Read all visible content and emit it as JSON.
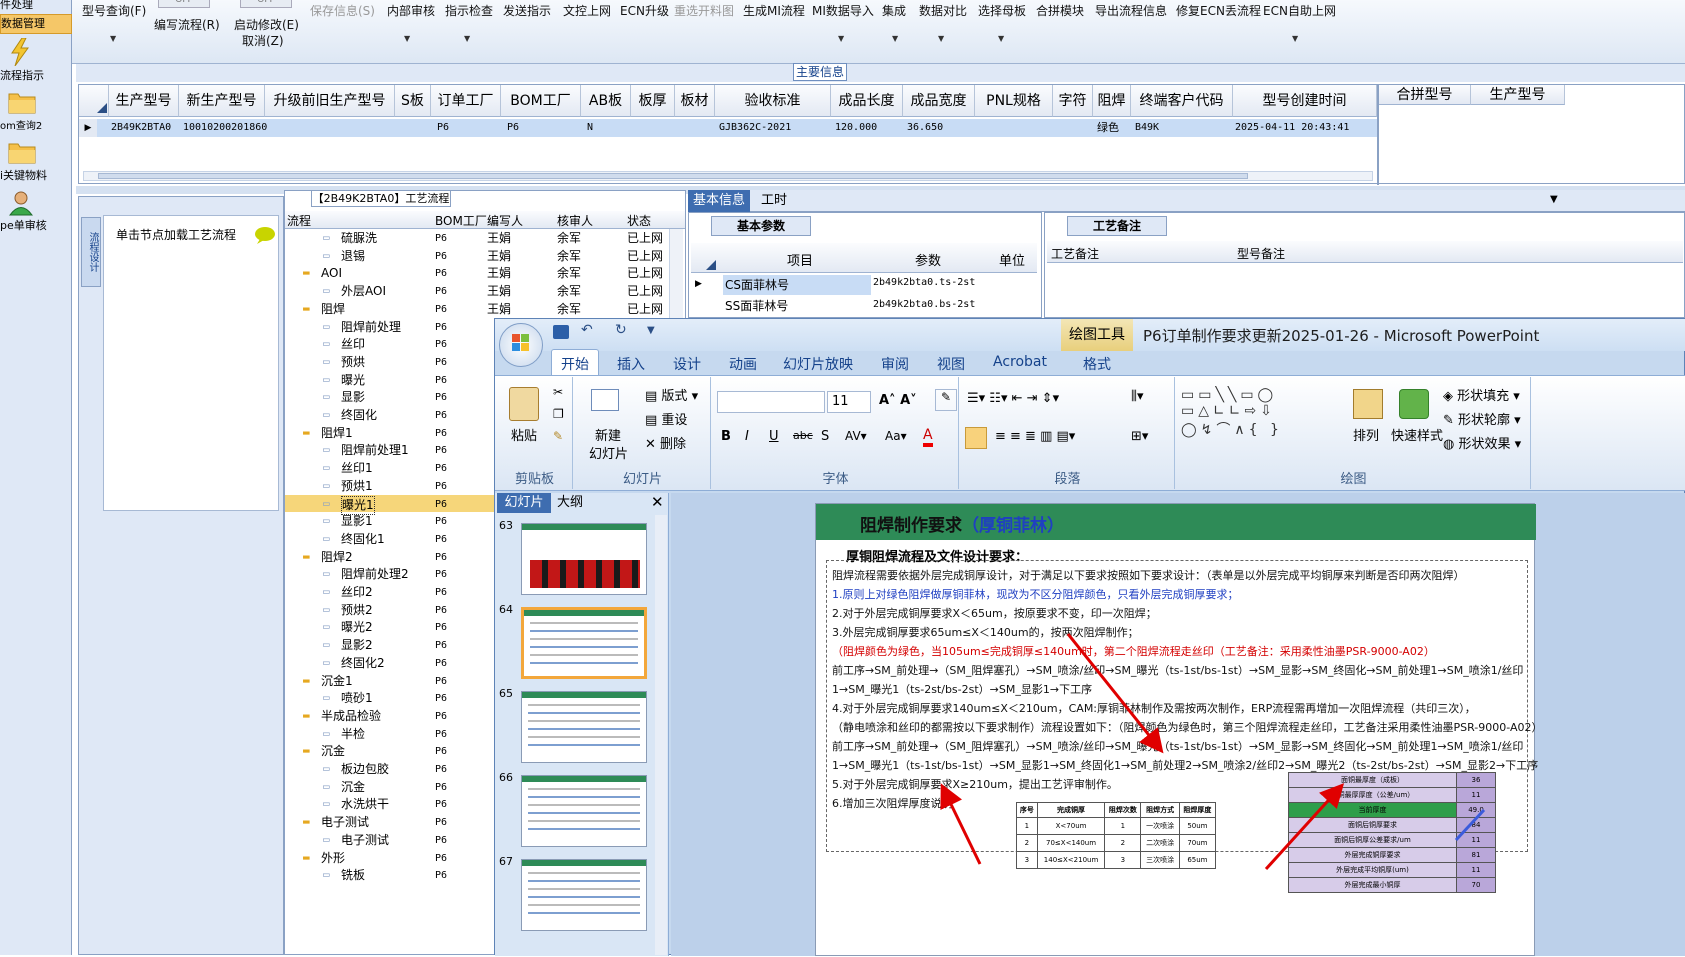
{
  "leftnav": {
    "items": [
      "件处理",
      "数据管理",
      "流程指示",
      "om查询2",
      "i关键物料",
      "pe单审核"
    ]
  },
  "toolbar": {
    "buttons": [
      "型号查询(F)",
      "编写流程(R)",
      "启动修改(E)",
      "保存信息(S)",
      "内部审核",
      "指示检查",
      "发送指示",
      "文控上网",
      "ECN升级",
      "重选开料图",
      "生成MI流程",
      "MI数据导入",
      "集成",
      "数据对比",
      "选择母板",
      "合拼模块",
      "导出流程信息",
      "修复ECN丢流程",
      "ECN自助上网"
    ],
    "cancel": "取消(Z)",
    "off1": "OFF",
    "off2": "OFF"
  },
  "main": {
    "title": "主要信息",
    "columns": [
      "生产型号",
      "新生产型号",
      "升级前旧生产型号",
      "S板",
      "订单工厂",
      "BOM工厂",
      "AB板",
      "板厚",
      "板材",
      "验收标准",
      "成品长度",
      "成品宽度",
      "PNL规格",
      "字符",
      "阻焊",
      "终端客户代码",
      "型号创建时间"
    ],
    "row": [
      "2B49K2BTA0",
      "10010200201860",
      "",
      "",
      "P6",
      "P6",
      "N",
      "",
      "",
      "GJB362C-2021",
      "120.000",
      "36.650",
      "",
      "",
      "绿色",
      "B49K",
      "2025-04-11 20:43:41"
    ],
    "right_columns": [
      "合拼型号",
      "生产型号"
    ]
  },
  "process": {
    "title": "【2B49K2BTA0】工艺流程",
    "side_tab": "流程设计",
    "load_hint": "单击节点加载工艺流程",
    "columns": [
      "流程",
      "BOM工厂",
      "编写人",
      "核审人",
      "状态"
    ],
    "rows": [
      {
        "name": "硫脲洗",
        "level": 2,
        "bom": "P6",
        "writer": "王娟",
        "reviewer": "余军",
        "status": "已上网"
      },
      {
        "name": "退锡",
        "level": 2,
        "bom": "P6",
        "writer": "王娟",
        "reviewer": "余军",
        "status": "已上网"
      },
      {
        "name": "AOI",
        "level": 1,
        "bom": "P6",
        "writer": "王娟",
        "reviewer": "余军",
        "status": "已上网"
      },
      {
        "name": "外层AOI",
        "level": 2,
        "bom": "P6",
        "writer": "王娟",
        "reviewer": "余军",
        "status": "已上网"
      },
      {
        "name": "阻焊",
        "level": 1,
        "bom": "P6",
        "writer": "王娟",
        "reviewer": "余军",
        "status": "已上网"
      },
      {
        "name": "阻焊前处理",
        "level": 2,
        "bom": "P6",
        "writer": "",
        "reviewer": "",
        "status": ""
      },
      {
        "name": "丝印",
        "level": 2,
        "bom": "P6",
        "writer": "",
        "reviewer": "",
        "status": ""
      },
      {
        "name": "预烘",
        "level": 2,
        "bom": "P6",
        "writer": "",
        "reviewer": "",
        "status": ""
      },
      {
        "name": "曝光",
        "level": 2,
        "bom": "P6",
        "writer": "",
        "reviewer": "",
        "status": ""
      },
      {
        "name": "显影",
        "level": 2,
        "bom": "P6",
        "writer": "",
        "reviewer": "",
        "status": ""
      },
      {
        "name": "终固化",
        "level": 2,
        "bom": "P6",
        "writer": "",
        "reviewer": "",
        "status": ""
      },
      {
        "name": "阻焊1",
        "level": 1,
        "bom": "P6",
        "writer": "",
        "reviewer": "",
        "status": ""
      },
      {
        "name": "阻焊前处理1",
        "level": 2,
        "bom": "P6",
        "writer": "",
        "reviewer": "",
        "status": ""
      },
      {
        "name": "丝印1",
        "level": 2,
        "bom": "P6",
        "writer": "",
        "reviewer": "",
        "status": ""
      },
      {
        "name": "预烘1",
        "level": 2,
        "bom": "P6",
        "writer": "",
        "reviewer": "",
        "status": ""
      },
      {
        "name": "曝光1",
        "level": 2,
        "bom": "P6",
        "writer": "",
        "reviewer": "",
        "status": "",
        "selected": true
      },
      {
        "name": "显影1",
        "level": 2,
        "bom": "P6",
        "writer": "",
        "reviewer": "",
        "status": ""
      },
      {
        "name": "终固化1",
        "level": 2,
        "bom": "P6",
        "writer": "",
        "reviewer": "",
        "status": ""
      },
      {
        "name": "阻焊2",
        "level": 1,
        "bom": "P6",
        "writer": "",
        "reviewer": "",
        "status": ""
      },
      {
        "name": "阻焊前处理2",
        "level": 2,
        "bom": "P6",
        "writer": "",
        "reviewer": "",
        "status": ""
      },
      {
        "name": "丝印2",
        "level": 2,
        "bom": "P6",
        "writer": "",
        "reviewer": "",
        "status": ""
      },
      {
        "name": "预烘2",
        "level": 2,
        "bom": "P6",
        "writer": "",
        "reviewer": "",
        "status": ""
      },
      {
        "name": "曝光2",
        "level": 2,
        "bom": "P6",
        "writer": "",
        "reviewer": "",
        "status": ""
      },
      {
        "name": "显影2",
        "level": 2,
        "bom": "P6",
        "writer": "",
        "reviewer": "",
        "status": ""
      },
      {
        "name": "终固化2",
        "level": 2,
        "bom": "P6",
        "writer": "",
        "reviewer": "",
        "status": ""
      },
      {
        "name": "沉金1",
        "level": 1,
        "bom": "P6",
        "writer": "",
        "reviewer": "",
        "status": ""
      },
      {
        "name": "喷砂1",
        "level": 2,
        "bom": "P6",
        "writer": "",
        "reviewer": "",
        "status": ""
      },
      {
        "name": "半成品检验",
        "level": 1,
        "bom": "P6",
        "writer": "",
        "reviewer": "",
        "status": ""
      },
      {
        "name": "半检",
        "level": 2,
        "bom": "P6",
        "writer": "",
        "reviewer": "",
        "status": ""
      },
      {
        "name": "沉金",
        "level": 1,
        "bom": "P6",
        "writer": "",
        "reviewer": "",
        "status": ""
      },
      {
        "name": "板边包胶",
        "level": 2,
        "bom": "P6",
        "writer": "",
        "reviewer": "",
        "status": ""
      },
      {
        "name": "沉金",
        "level": 2,
        "bom": "P6",
        "writer": "",
        "reviewer": "",
        "status": ""
      },
      {
        "name": "水洗烘干",
        "level": 2,
        "bom": "P6",
        "writer": "",
        "reviewer": "",
        "status": ""
      },
      {
        "name": "电子测试",
        "level": 1,
        "bom": "P6",
        "writer": "",
        "reviewer": "",
        "status": ""
      },
      {
        "name": "电子测试",
        "level": 2,
        "bom": "P6",
        "writer": "",
        "reviewer": "",
        "status": ""
      },
      {
        "name": "外形",
        "level": 1,
        "bom": "P6",
        "writer": "",
        "reviewer": "",
        "status": ""
      },
      {
        "name": "铣板",
        "level": 2,
        "bom": "P6",
        "writer": "",
        "reviewer": "",
        "status": ""
      }
    ]
  },
  "info": {
    "tabs": [
      "基本信息",
      "工时"
    ],
    "basic_title": "基本参数",
    "basic_columns": [
      "项目",
      "参数",
      "单位"
    ],
    "basic_rows": [
      {
        "item": "CS面菲林号",
        "param": "2b49k2bta0.ts-2st"
      },
      {
        "item": "SS面菲林号",
        "param": "2b49k2bta0.bs-2st"
      }
    ],
    "remark_title": "工艺备注",
    "remark_columns": [
      "工艺备注",
      "型号备注"
    ]
  },
  "ppt": {
    "title": "P6订单制作要求更新2025-01-26 - Microsoft PowerPoint",
    "drawing_tools": "绘图工具",
    "tabs": [
      "开始",
      "插入",
      "设计",
      "动画",
      "幻灯片放映",
      "审阅",
      "视图",
      "Acrobat",
      "格式"
    ],
    "groups": {
      "clipboard": {
        "title": "剪贴板",
        "paste": "粘贴"
      },
      "slides": {
        "title": "幻灯片",
        "new": "新建",
        "new2": "幻灯片",
        "layout": "版式",
        "reset": "重设",
        "delete": "删除"
      },
      "font": {
        "title": "字体",
        "size": "11"
      },
      "paragraph": {
        "title": "段落"
      },
      "drawing": {
        "title": "绘图",
        "arrange": "排列",
        "quick": "快速样式",
        "fill": "形状填充",
        "outline": "形状轮廓",
        "effect": "形状效果"
      }
    },
    "panel_tabs": [
      "幻灯片",
      "大纲"
    ],
    "thumbs": [
      "63",
      "64",
      "65",
      "66",
      "67"
    ],
    "slide": {
      "title": "阻焊制作要求",
      "title_em": "（厚铜菲林）",
      "subtitle": "厚铜阻焊流程及文件设计要求：",
      "lines": [
        "阻焊流程需要依据外层完成铜厚设计，对于满足以下要求按照如下要求设计：（表单是以外层完成平均铜厚来判断是否印两次阻焊）",
        "1.原则上对绿色阻焊做厚铜菲林，现改为不区分阻焊颜色，只看外层完成铜厚要求；",
        "2.对于外层完成铜厚要求X＜65um，按原要求不变，印一次阻焊；",
        "3.外层完成铜厚要求65um≤X＜140um的，按两次阻焊制作；",
        "（阻焊颜色为绿色，当105um≤完成铜厚≤140um时，第二个阻焊流程走丝印（工艺备注：采用柔性油墨PSR-9000-A02）",
        "前工序→SM_前处理→（SM_阻焊塞孔）→SM_喷涂/丝印→SM_曝光（ts-1st/bs-1st）→SM_显影→SM_终固化→SM_前处理1→SM_喷涂1/丝印",
        "1→SM_曝光1（ts-2st/bs-2st）→SM_显影1→下工序",
        "4.对于外层完成铜厚要求140um≤X＜210um，CAM:厚铜菲林制作及需按两次制作，ERP流程需再增加一次阻焊流程（共印三次），",
        "（静电喷涂和丝印的都需按以下要求制作）流程设置如下：（阻焊颜色为绿色时，第三个阻焊流程走丝印，工艺备注采用柔性油墨PSR-9000-A02）",
        "前工序→SM_前处理→（SM_阻焊塞孔）→SM_喷涂/丝印→SM_曝光（ts-1st/bs-1st）→SM_显影→SM_终固化→SM_前处理1→SM_喷涂1/丝印",
        "1→SM_曝光1（ts-1st/bs-1st）→SM_显影1→SM_终固化1→SM_前处理2→SM_喷涂2/丝印2→SM_曝光2（ts-2st/bs-2st）→SM_显影2→下工序",
        "5.对于外层完成铜厚要求X≥210um，提出工艺评审制作。",
        "6.增加三次阻焊厚度说明"
      ],
      "table_headers": [
        "序号",
        "完成铜厚",
        "阻焊次数",
        "阻焊方式",
        "阻焊厚度"
      ],
      "table_rows": [
        [
          "1",
          "X<70um",
          "1",
          "一次喷涂",
          "50um"
        ],
        [
          "2",
          "70≤X<140um",
          "2",
          "二次喷涂",
          "70um"
        ],
        [
          "3",
          "140≤X<210um",
          "3",
          "三次喷涂",
          "65um"
        ]
      ],
      "table2": [
        [
          "面铜最厚度（成板）",
          "36"
        ],
        [
          "面铜最厚厚度（公差/um）",
          "11"
        ],
        [
          "当前厚度",
          "49.0"
        ],
        [
          "面铜后铜厚要求",
          "84"
        ],
        [
          "面铜后铜厚公差要求/um",
          "11"
        ],
        [
          "外层完成铜厚要求",
          "81"
        ],
        [
          "外层完成平均铜厚(um)",
          "11"
        ],
        [
          "外层完成最小铜厚",
          "70"
        ]
      ]
    }
  },
  "colors": {
    "accent": "#15428b",
    "selection": "#c8dcf5",
    "slide_header": "#2e8b57",
    "arrow": "#e00000"
  }
}
